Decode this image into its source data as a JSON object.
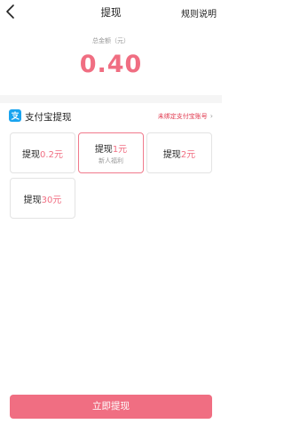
{
  "header": {
    "title": "提现",
    "rules_label": "规则说明"
  },
  "total": {
    "label": "总金额（元）",
    "amount": "0.40"
  },
  "method": {
    "label": "支付宝提现",
    "bind_label": "未绑定支付宝账号",
    "icon": "alipay-icon"
  },
  "options": [
    {
      "prefix": "提现",
      "amount": "0.2元",
      "sub": ""
    },
    {
      "prefix": "提现",
      "amount": "1元",
      "sub": "新人福利"
    },
    {
      "prefix": "提现",
      "amount": "2元",
      "sub": ""
    },
    {
      "prefix": "提现",
      "amount": "30元",
      "sub": ""
    }
  ],
  "selected_option": 1,
  "submit_label": "立即提现",
  "colors": {
    "accent": "#f06e82",
    "warning_text": "#e0394f",
    "alipay_blue": "#1aa4ef",
    "divider": "#f5f5f5"
  }
}
